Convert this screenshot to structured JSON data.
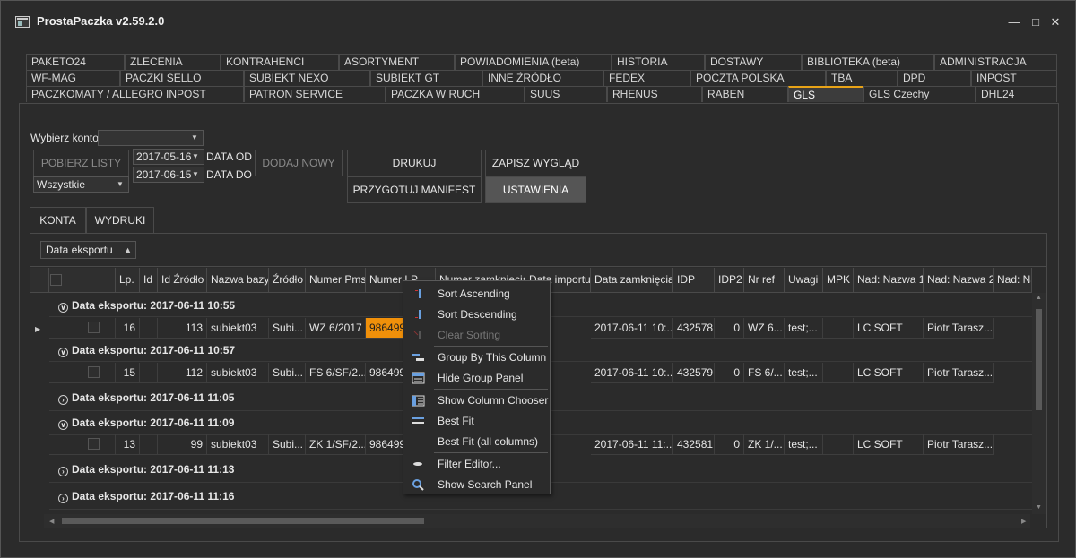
{
  "window": {
    "title": "ProstaPaczka v2.59.2.0"
  },
  "tabs": {
    "row1": [
      "PAKETO24",
      "ZLECENIA",
      "KONTRAHENCI",
      "ASORTYMENT",
      "POWIADOMIENIA (beta)",
      "HISTORIA",
      "DOSTAWY",
      "BIBLIOTEKA (beta)",
      "ADMINISTRACJA"
    ],
    "row2": [
      "WF-MAG",
      "PACZKI SELLO",
      "SUBIEKT NEXO",
      "SUBIEKT GT",
      "INNE ŹRÓDŁO",
      "FEDEX",
      "POCZTA POLSKA",
      "TBA",
      "DPD",
      "INPOST"
    ],
    "row3": [
      "PACZKOMATY / ALLEGRO INPOST",
      "PATRON SERVICE",
      "PACZKA W RUCH",
      "SUUS",
      "RHENUS",
      "RABEN",
      "GLS",
      "GLS Czechy",
      "DHL24"
    ],
    "active": "GLS"
  },
  "toolbar": {
    "account_label": "Wybierz konto:",
    "account_value": "",
    "fetch_button": "POBIERZ LISTY",
    "date_from": "2017-05-16",
    "date_to": "2017-06-15",
    "date_from_label": "DATA OD",
    "date_to_label": "DATA DO",
    "filter_value": "Wszystkie",
    "add_new_button": "DODAJ NOWY",
    "print_button": "DRUKUJ",
    "manifest_button": "PRZYGOTUJ MANIFEST",
    "save_layout_button": "ZAPISZ WYGLĄD",
    "settings_button": "USTAWIENIA"
  },
  "subtabs": [
    "KONTA",
    "WYDRUKI"
  ],
  "grid": {
    "group_chip": "Data eksportu",
    "columns": [
      "Lp.",
      "Id",
      "Id Źródło",
      "Nazwa bazy",
      "Źródło",
      "Numer Pms",
      "Numer LP",
      "Numer zamknięcia",
      "Data importu",
      "Data zamknięcia",
      "IDP",
      "IDP2",
      "Nr ref",
      "Uwagi",
      "MPK",
      "Nad: Nazwa 1",
      "Nad: Nazwa 2",
      "Nad: Na"
    ],
    "groups": [
      {
        "label": "Data eksportu: 2017-06-11 10:55",
        "row": {
          "lp": "16",
          "id_zrodlo": "113",
          "nazwa_bazy": "subiekt03",
          "zrodlo": "Subi...",
          "numer_pms": "WZ 6/2017",
          "numer_lp": "986499",
          "data_zamkniecia": "2017-06-11 10:...",
          "idp": "432578",
          "idp2": "0",
          "nr_ref": "WZ 6...",
          "uwagi": "test;...",
          "nad1": "LC SOFT",
          "nad2": "Piotr Tarasz..."
        }
      },
      {
        "label": "Data eksportu: 2017-06-11 10:57",
        "row": {
          "lp": "15",
          "id_zrodlo": "112",
          "nazwa_bazy": "subiekt03",
          "zrodlo": "Subi...",
          "numer_pms": "FS 6/SF/2...",
          "numer_lp": "986499",
          "data_zamkniecia": "2017-06-11 10:...",
          "idp": "432579",
          "idp2": "0",
          "nr_ref": "FS 6/...",
          "uwagi": "test;...",
          "nad1": "LC SOFT",
          "nad2": "Piotr Tarasz..."
        }
      },
      {
        "label": "Data eksportu: 2017-06-11 11:05"
      },
      {
        "label": "Data eksportu: 2017-06-11 11:09",
        "row": {
          "lp": "13",
          "id_zrodlo": "99",
          "nazwa_bazy": "subiekt03",
          "zrodlo": "Subi...",
          "numer_pms": "ZK 1/SF/2...",
          "numer_lp": "986499",
          "data_zamkniecia": "2017-06-11 11:...",
          "idp": "432581",
          "idp2": "0",
          "nr_ref": "ZK 1/...",
          "uwagi": "test;...",
          "nad1": "LC SOFT",
          "nad2": "Piotr Tarasz..."
        }
      },
      {
        "label": "Data eksportu: 2017-06-11 11:13"
      },
      {
        "label": "Data eksportu: 2017-06-11 11:16"
      }
    ]
  },
  "context_menu": {
    "items": [
      "Sort Ascending",
      "Sort Descending",
      "Clear Sorting",
      "Group By This Column",
      "Hide Group Panel",
      "Show Column Chooser",
      "Best Fit",
      "Best Fit (all columns)",
      "Filter Editor...",
      "Show Search Panel"
    ]
  }
}
